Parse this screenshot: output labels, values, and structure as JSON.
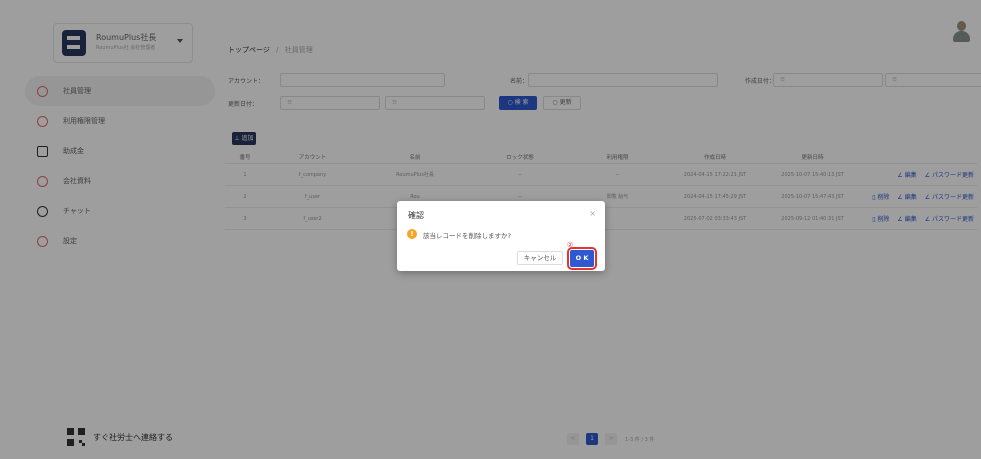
{
  "sidebar": {
    "company_name": "RoumuPlus社長",
    "company_sub": "RoumuPlus社 会社管理者",
    "items": [
      {
        "label": "社員管理",
        "active": true
      },
      {
        "label": "利用権限管理"
      },
      {
        "label": "助成金"
      },
      {
        "label": "会社資料"
      },
      {
        "label": "チャット"
      },
      {
        "label": "設定"
      }
    ],
    "contact_label": "すぐ社労士へ連絡する"
  },
  "header": {
    "breadcrumb_top": "トップページ",
    "breadcrumb_sep": "/",
    "breadcrumb_current": "社員管理"
  },
  "filters": {
    "account_label": "アカウント：",
    "name_label": "名前：",
    "created_label": "作成日付：",
    "updated_label": "更新日付：",
    "date_placeholder": "日",
    "range_sep": "-",
    "search_button": "○ 検 索",
    "reset_button": "○ 更新",
    "add_button": "⊥ 追加"
  },
  "table": {
    "headers": [
      "番号",
      "アカウント",
      "名前",
      "ロック状態",
      "利用権限",
      "作成日時",
      "更新日時",
      ""
    ],
    "rows": [
      {
        "no": "1",
        "account": "f_company",
        "name": "RoumuPlus社長",
        "lock": "--",
        "perm": "--",
        "created": "2024-04-15 17:22:21 JST",
        "updated": "2025-10-07 15:40:13 JST",
        "actions": [
          "∠ 編集",
          "∠ パスワード更新"
        ]
      },
      {
        "no": "2",
        "account": "f_user",
        "name": "Rou",
        "lock": "--",
        "perm": "閲覧 給与",
        "created": "2024-04-15 17:45:29 JST",
        "updated": "2025-10-07 15:47:43 JST",
        "actions": [
          "▯ 削除",
          "∠ 編集",
          "∠ パスワード更新"
        ]
      },
      {
        "no": "3",
        "account": "f_user2",
        "name": "Rou",
        "lock": "",
        "perm": "",
        "created": "2025-07-02 03:33:43 JST",
        "updated": "2025-09-12 01:40:31 JST",
        "actions": [
          "▯ 削除",
          "∠ 編集",
          "∠ パスワード更新"
        ]
      }
    ]
  },
  "pagination": {
    "prev": "<",
    "current": "1",
    "next": ">",
    "info": "1-3 件 / 3 件"
  },
  "dialog": {
    "title": "確認",
    "close": "×",
    "warning_glyph": "!",
    "message": "該当レコードを削除しますか?",
    "cancel": "キャンセル",
    "ok": "O K",
    "step_marker": "②"
  },
  "colors": {
    "primary": "#2f58d1",
    "navy": "#27375f",
    "highlight": "#e3342f",
    "warning": "#f5a623"
  }
}
